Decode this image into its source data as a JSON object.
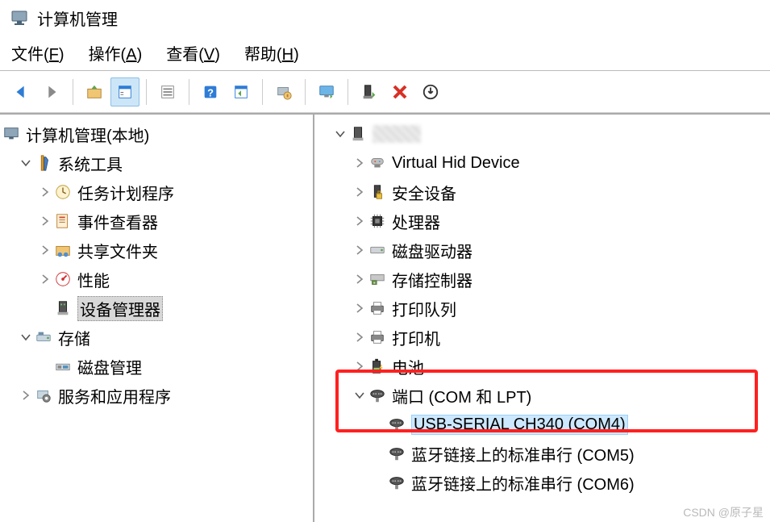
{
  "title": "计算机管理",
  "menu": {
    "file": "文件(F)",
    "action": "操作(A)",
    "view": "查看(V)",
    "help": "帮助(H)"
  },
  "toolbar": {
    "back": "back",
    "forward": "forward",
    "up": "up",
    "props": "properties",
    "list": "list",
    "help": "help",
    "refresh": "refresh",
    "scan": "scan-hardware",
    "monitor": "monitor",
    "enable": "enable-device",
    "disable": "disable-device",
    "update": "update-driver"
  },
  "left_tree": {
    "root": "计算机管理(本地)",
    "sys_tools": "系统工具",
    "task_scheduler": "任务计划程序",
    "event_viewer": "事件查看器",
    "shared_folders": "共享文件夹",
    "performance": "性能",
    "device_manager": "设备管理器",
    "storage": "存储",
    "disk_mgmt": "磁盘管理",
    "services_apps": "服务和应用程序"
  },
  "right_tree": {
    "virtual_hid": "Virtual Hid Device",
    "security_devices": "安全设备",
    "processors": "处理器",
    "disk_drives": "磁盘驱动器",
    "storage_ctrl": "存储控制器",
    "print_queues": "打印队列",
    "printers": "打印机",
    "batteries": "电池",
    "ports": "端口 (COM 和 LPT)",
    "usb_serial": "USB-SERIAL CH340 (COM4)",
    "bt_serial5": "蓝牙链接上的标准串行 (COM5)",
    "bt_serial6": "蓝牙链接上的标准串行 (COM6)"
  },
  "watermark": "CSDN @原子星"
}
